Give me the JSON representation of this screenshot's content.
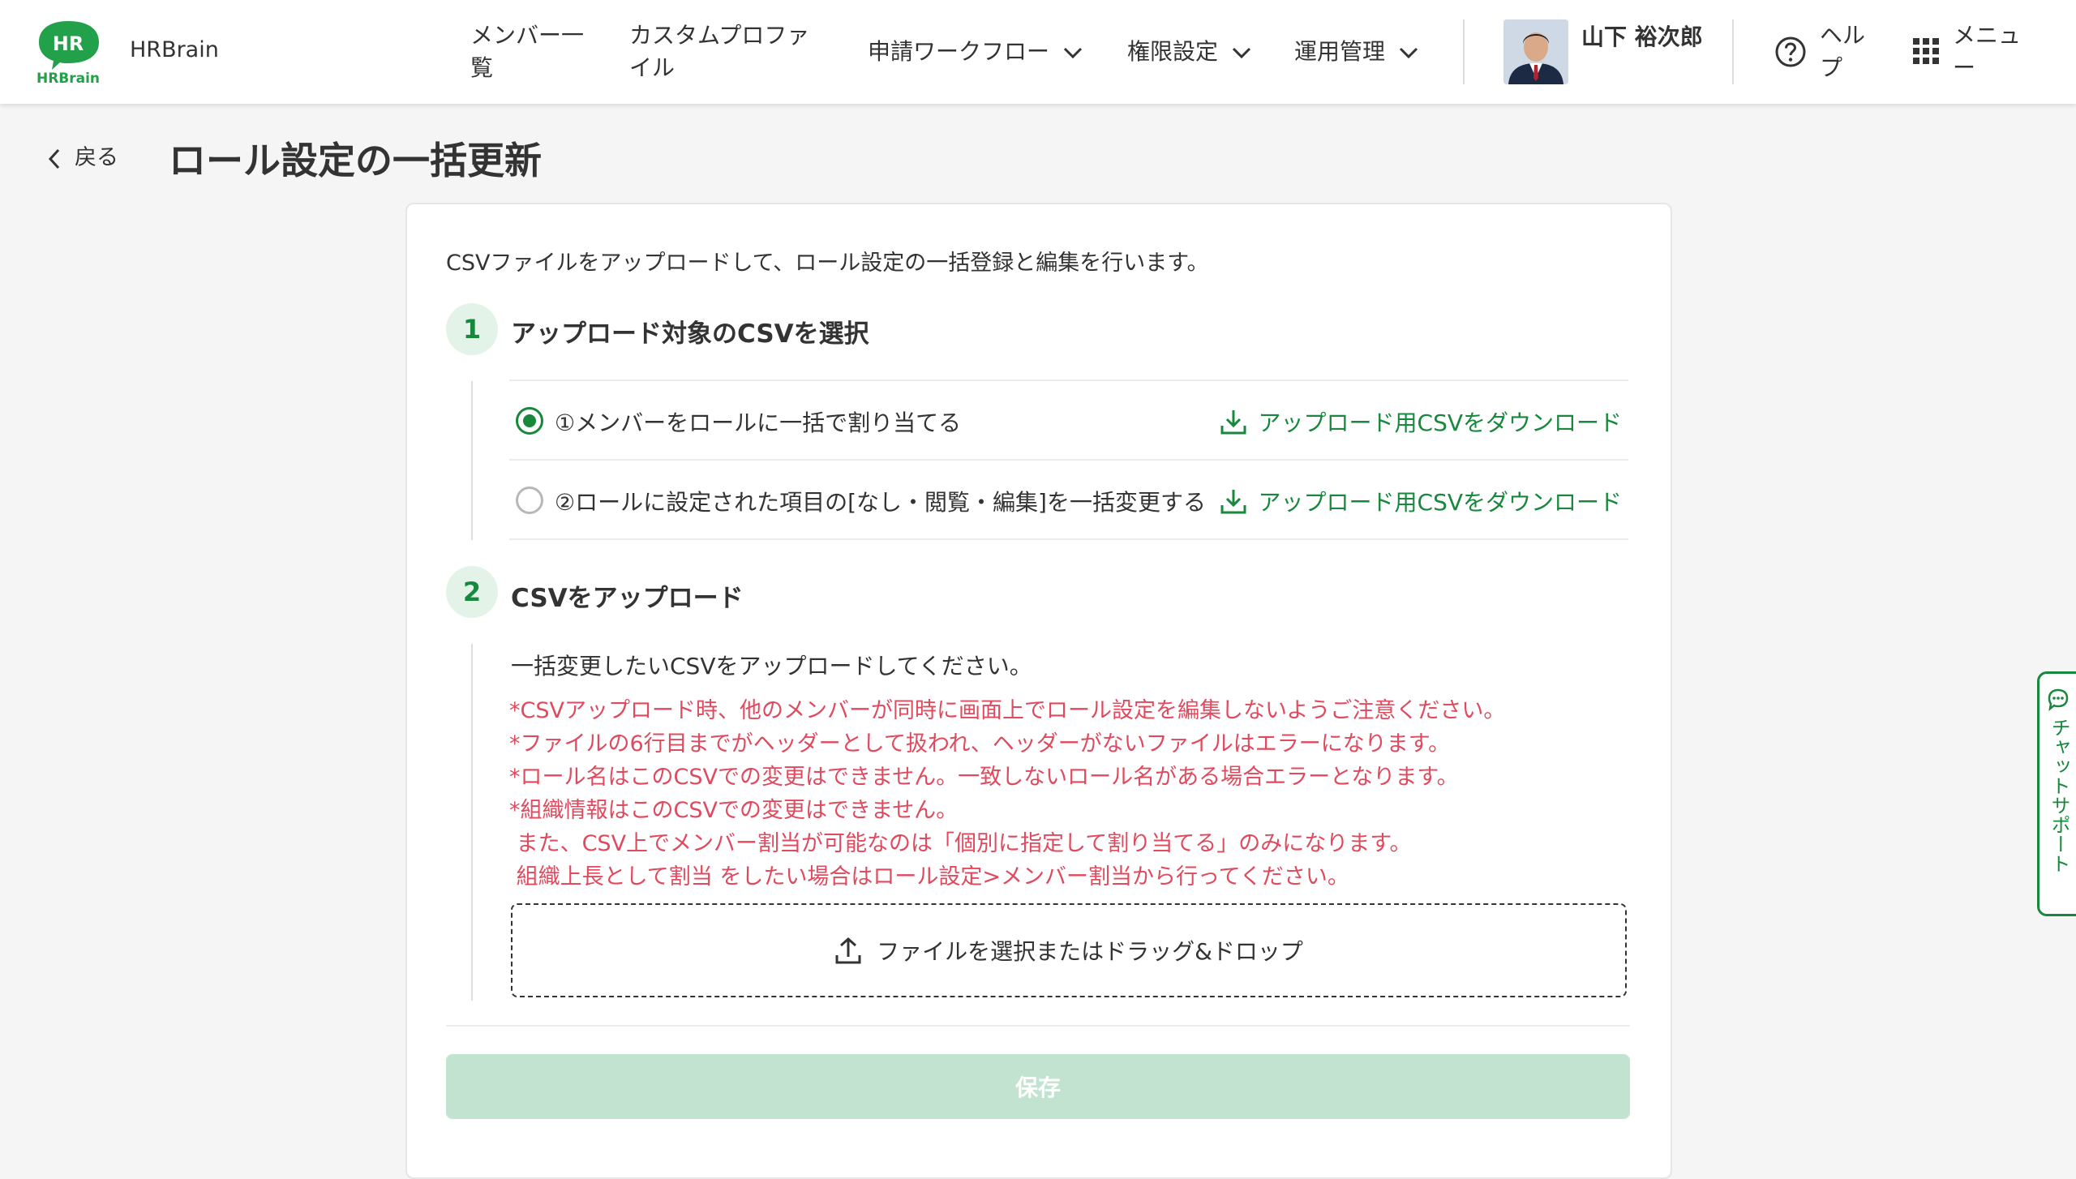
{
  "app": {
    "brand": "HRBrain",
    "logo_text": "HR",
    "logo_sub": "HRBrain"
  },
  "nav": [
    {
      "label": "メンバー一覧",
      "has_dropdown": false
    },
    {
      "label": "カスタムプロファイル",
      "has_dropdown": false
    },
    {
      "label": "申請ワークフロー",
      "has_dropdown": true
    },
    {
      "label": "権限設定",
      "has_dropdown": true
    },
    {
      "label": "運用管理",
      "has_dropdown": true
    }
  ],
  "user": {
    "name": "山下 裕次郎"
  },
  "help": {
    "label": "ヘルプ",
    "icon": "help-circle-icon"
  },
  "menu": {
    "label": "メニュー",
    "icon": "grid-icon"
  },
  "page": {
    "back_label": "戻る",
    "title": "ロール設定の一括更新"
  },
  "intro": "CSVファイルをアップロードして、ロール設定の一括登録と編集を行います。",
  "step1": {
    "number": "1",
    "title": "アップロード対象のCSVを選択",
    "options": [
      {
        "label": "①メンバーをロールに一括で割り当てる",
        "selected": true,
        "download_label": "アップロード用CSVをダウンロード"
      },
      {
        "label": "②ロールに設定された項目の[なし・閲覧・編集]を一括変更する",
        "selected": false,
        "download_label": "アップロード用CSVをダウンロード"
      }
    ]
  },
  "step2": {
    "number": "2",
    "title": "CSVをアップロード",
    "description": "一括変更したいCSVをアップロードしてください。",
    "notes": [
      "*CSVアップロード時、他のメンバーが同時に画面上でロール設定を編集しないようご注意ください。",
      "*ファイルの6行目までがヘッダーとして扱われ、ヘッダーがないファイルはエラーになります。",
      "*ロール名はこのCSVでの変更はできません。一致しないロール名がある場合エラーとなります。",
      "*組織情報はこのCSVでの変更はできません。",
      " また、CSV上でメンバー割当が可能なのは「個別に指定して割り当てる」のみになります。",
      " 組織上長として割当 をしたい場合はロール設定>メンバー割当から行ってください。"
    ],
    "dropzone_label": "ファイルを選択またはドラッグ&ドロップ"
  },
  "save_label": "保存",
  "chat_support_label": "チャットサポート",
  "colors": {
    "accent": "#17883c",
    "warning": "#e04a5e",
    "disabled_button": "#c2e3cf"
  }
}
